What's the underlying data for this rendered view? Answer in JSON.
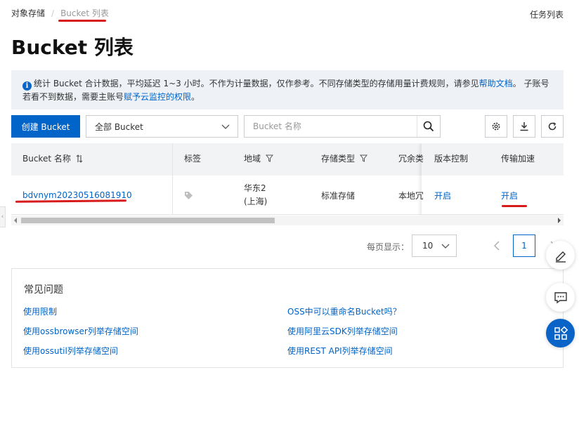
{
  "breadcrumb": {
    "root": "对象存储",
    "separator": "/",
    "current": "Bucket 列表"
  },
  "header": {
    "task_link": "任务列表",
    "title": "Bucket 列表"
  },
  "notice": {
    "text_1": "统计 Bucket 合计数据，平均延迟 1~3 小时。不作为计量数据，仅作参考。不同存储类型的存储用量计费规则，请参见",
    "link_1": "帮助文档",
    "text_2": "。 子账号若看不到数据，需要主账号",
    "link_2": "赋予云监控的权限",
    "text_3": "。"
  },
  "toolbar": {
    "create_label": "创建 Bucket",
    "filter_value": "全部 Bucket",
    "search_placeholder": "Bucket 名称",
    "icons": [
      "settings-icon",
      "download-icon",
      "refresh-icon"
    ]
  },
  "table": {
    "columns": [
      "Bucket 名称",
      "标签",
      "地域",
      "存储类型",
      "冗余类",
      "版本控制",
      "传输加速"
    ],
    "rows": [
      {
        "name": "bdvnym20230516081910",
        "region_line1": "华东2",
        "region_line2": "(上海)",
        "storage_type": "标准存储",
        "redundancy": "本地冗",
        "versioning": "开启",
        "acceleration": "开启"
      }
    ]
  },
  "pagination": {
    "label": "每页显示：",
    "page_size": "10",
    "current_page": "1"
  },
  "faq": {
    "title": "常见问题",
    "left": [
      "使用限制",
      "使用ossbrowser列举存储空间",
      "使用ossutil列举存储空间"
    ],
    "right": [
      "OSS中可以重命名Bucket吗？",
      "使用阿里云SDK列举存储空间",
      "使用REST API列举存储空间"
    ]
  },
  "colors": {
    "primary": "#0064c8",
    "annotation_red": "#d71a1a",
    "notice_bg": "#eef2f7"
  }
}
